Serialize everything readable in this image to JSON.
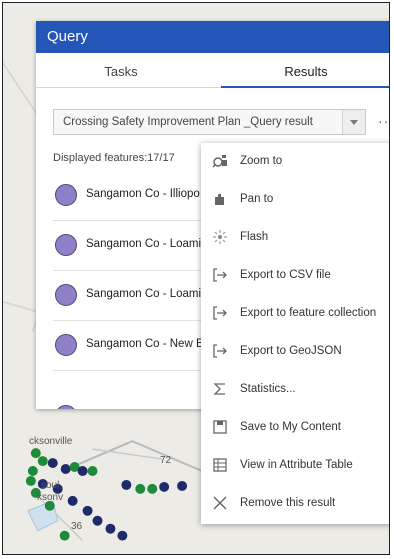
{
  "map": {
    "place_labels": [
      "cksonville",
      "soul",
      "ksonv"
    ],
    "route_labels": [
      "72",
      "36"
    ]
  },
  "query_panel": {
    "title": "Query",
    "tabs": [
      {
        "label": "Tasks",
        "active": false
      },
      {
        "label": "Results",
        "active": true
      }
    ],
    "result_select": {
      "value": "Crossing Safety Improvement Plan _Query result"
    },
    "more_label": "···",
    "displayed_features": "Displayed features:17/17",
    "results": [
      {
        "label": "Sangamon Co - Illiopo",
        "symbol_color": "#8f80c9"
      },
      {
        "label": "Sangamon Co - Loami",
        "symbol_color": "#8f80c9"
      },
      {
        "label": "Sangamon Co - Loami",
        "symbol_color": "#8f80c9"
      },
      {
        "label": "Sangamon Co - New B",
        "symbol_color": "#8f80c9"
      }
    ]
  },
  "context_menu": {
    "items": [
      {
        "label": "Zoom to",
        "icon": "zoom-to-icon"
      },
      {
        "label": "Pan to",
        "icon": "pan-to-icon"
      },
      {
        "label": "Flash",
        "icon": "flash-icon"
      },
      {
        "label": "Export to CSV file",
        "icon": "export-icon"
      },
      {
        "label": "Export to feature collection",
        "icon": "export-icon"
      },
      {
        "label": "Export to GeoJSON",
        "icon": "export-icon"
      },
      {
        "label": "Statistics...",
        "icon": "sigma-icon"
      },
      {
        "label": "Save to My Content",
        "icon": "save-icon"
      },
      {
        "label": "View in Attribute Table",
        "icon": "table-icon"
      },
      {
        "label": "Remove this result",
        "icon": "close-icon"
      }
    ]
  },
  "colors": {
    "header_blue": "#2456b8",
    "result_symbol": "#8f80c9",
    "map_green": "#1e8a3a",
    "map_navy": "#1f2a6b"
  }
}
